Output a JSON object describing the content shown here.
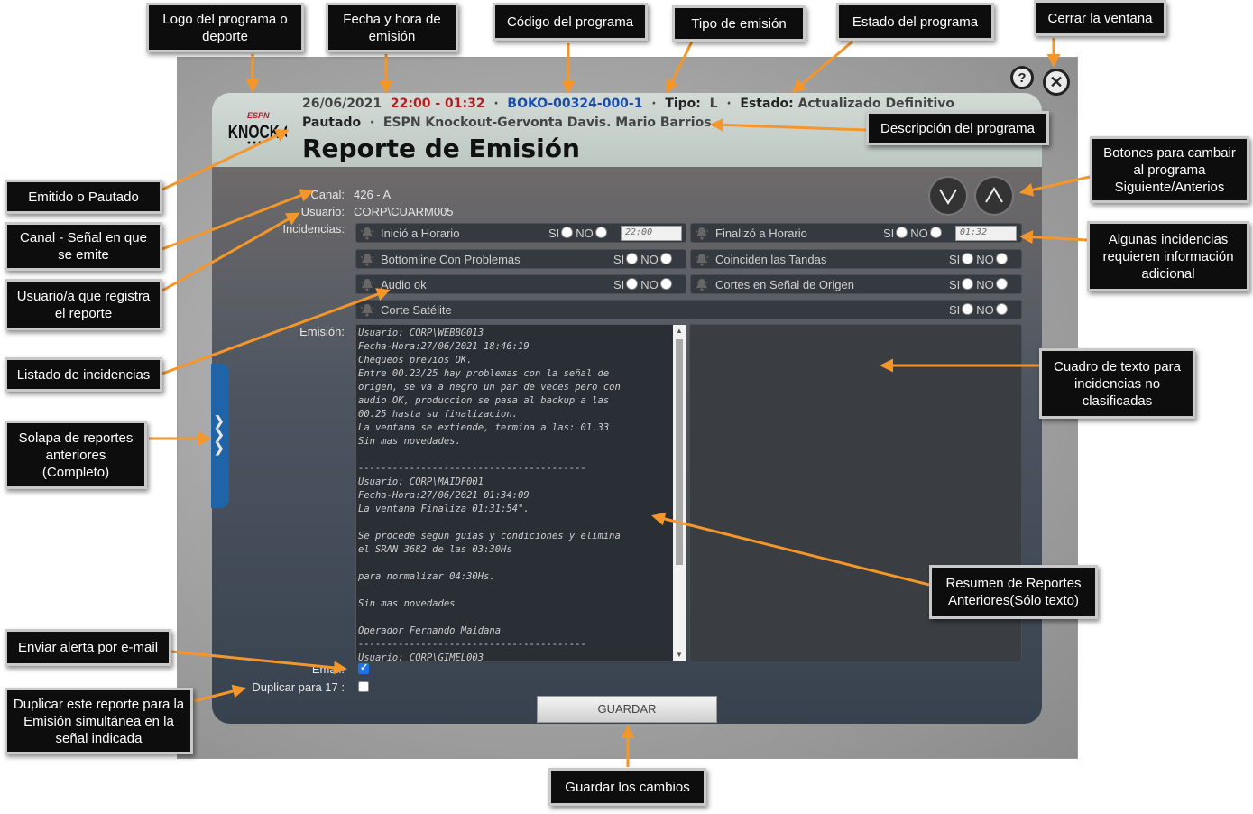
{
  "header": {
    "date": "26/06/2021",
    "time": "22:00 - 01:32",
    "code": "BOKO-00324-000-1",
    "tipo_label": "Tipo:",
    "tipo_value": "L",
    "estado_label": "Estado:",
    "estado_value": "Actualizado Definitivo",
    "status_word": "Pautado",
    "description": "ESPN Knockout-Gervonta Davis. Mario Barrios.",
    "title": "Reporte de Emisión",
    "separator": "·"
  },
  "logo": {
    "brand": "ESPN",
    "name": "KNOCK OUT"
  },
  "fields": {
    "canal_label": "Canal:",
    "canal_value": "426 - A",
    "usuario_label": "Usuario:",
    "usuario_value": "CORP\\CUARM005",
    "incidencias_label": "Incidencias:",
    "emision_label": "Emisión:",
    "email_label": "Email:",
    "duplicar_label": "Duplicar para 17 :"
  },
  "options": {
    "si": "SI",
    "no": "NO"
  },
  "incidencias": [
    {
      "name": "Inició a Horario",
      "time": "22:00"
    },
    {
      "name": "Finalizó a Horario",
      "time": "01:32"
    },
    {
      "name": "Bottomline Con Problemas"
    },
    {
      "name": "Coinciden las Tandas"
    },
    {
      "name": "Audio ok"
    },
    {
      "name": "Cortes en Señal de Origen"
    },
    {
      "name": "Corte Satélite"
    }
  ],
  "emision_text": "Usuario: CORP\\WEBBG013\nFecha-Hora:27/06/2021 18:46:19\nChequeos previos OK.\nEntre 00.23/25 hay problemas con la señal de\norigen, se va a negro un par de veces pero con\naudio OK, produccion se pasa al backup a las\n00.25 hasta su finalizacion.\nLa ventana se extiende, termina a las: 01.33\nSin mas novedades.\n\n----------------------------------------\nUsuario: CORP\\MAIDF001\nFecha-Hora:27/06/2021 01:34:09\nLa ventana Finaliza 01:31:54\".\n\nSe procede segun guias y condiciones y elimina\nel SRAN 3682 de las 03:30Hs\n\npara normalizar 04:30Hs.\n\nSin mas novedades\n\nOperador Fernando Maidana\n----------------------------------------\nUsuario: CORP\\GIMEL003",
  "email_checked": true,
  "duplicar_checked": false,
  "save_label": "GUARDAR",
  "help_glyph": "?",
  "close_glyph": "✕",
  "callouts": {
    "logo": "Logo del programa o deporte",
    "fecha": "Fecha y hora de emisión",
    "codigo": "Código del programa",
    "tipo": "Tipo de emisión",
    "estado": "Estado del programa",
    "cerrar": "Cerrar la ventana",
    "descripcion": "Descripción del programa",
    "botones": "Botones para cambair al programa Siguiente/Anterios",
    "emitido": "Emitido o Pautado",
    "canal": "Canal - Señal en que se emite",
    "usuario": "Usuario/a que registra el reporte",
    "listado": "Listado de incidencias",
    "algunas": "Algunas incidencias requieren información adicional",
    "cuadro": "Cuadro de texto para incidencias no clasificadas",
    "solapa": "Solapa de reportes anteriores (Completo)",
    "resumen": "Resumen de Reportes Anteriores(Sólo texto)",
    "enviar": "Enviar alerta por e-mail",
    "duplicar": "Duplicar este reporte para la Emisión simultánea en la señal indicada",
    "guardar": "Guardar los cambios"
  },
  "colors": {
    "callout_bg": "#0d0d0d",
    "arrow": "#f4962a",
    "accent_blue": "#1a4ea8",
    "accent_red": "#b02020"
  }
}
